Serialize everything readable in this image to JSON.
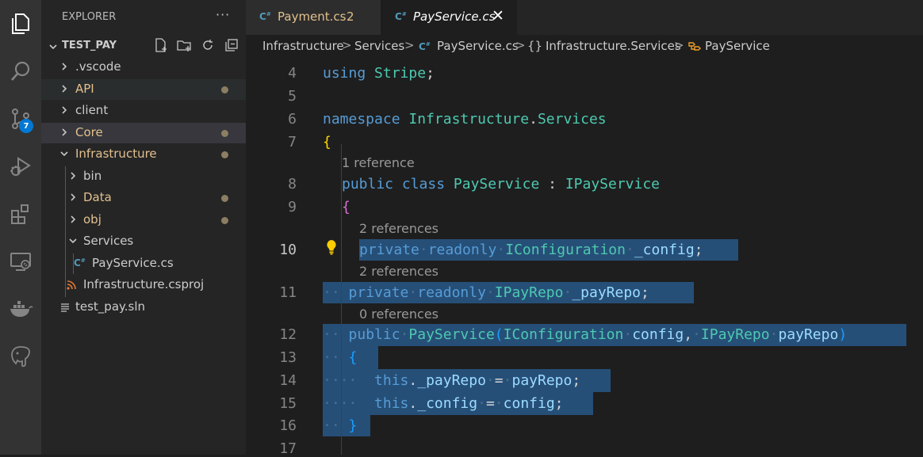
{
  "activity": {
    "scm_badge": "7"
  },
  "explorer": {
    "title": "EXPLORER",
    "more": "···",
    "root": "TEST_PAY",
    "items": [
      {
        "label": ".vscode"
      },
      {
        "label": "API"
      },
      {
        "label": "client"
      },
      {
        "label": "Core"
      },
      {
        "label": "Infrastructure"
      },
      {
        "label": "bin"
      },
      {
        "label": "Data"
      },
      {
        "label": "obj"
      },
      {
        "label": "Services"
      },
      {
        "label": "PayService.cs"
      },
      {
        "label": "Infrastructure.csproj"
      },
      {
        "label": "test_pay.sln"
      }
    ]
  },
  "tabs": [
    {
      "label": "Payment.cs",
      "problems": "2"
    },
    {
      "label": "PayService.cs"
    }
  ],
  "breadcrumb": {
    "items": [
      "Infrastructure",
      "Services",
      "PayService.cs",
      "Infrastructure.Services",
      "PayService"
    ],
    "sep": ">",
    "ns_glyph": "{}"
  },
  "code": {
    "line_numbers": [
      "4",
      "5",
      "6",
      "7",
      "8",
      "9",
      "10",
      "11",
      "12",
      "13",
      "14",
      "15",
      "16",
      "17"
    ],
    "lenses": [
      "1 reference",
      "2 references",
      "2 references",
      "0 references"
    ],
    "tokens": {
      "using": "using",
      "stripe": "Stripe",
      "semi": ";",
      "namespace": "namespace",
      "ns1": "Infrastructure",
      "dot": ".",
      "ns2": "Services",
      "lbrace": "{",
      "rbrace": "}",
      "public": "public",
      "class": "class",
      "payservice": "PayService",
      "colon": ":",
      "ipayservice": "IPayService",
      "private": "private",
      "readonly": "readonly",
      "iconfiguration": "IConfiguration",
      "config_field": "_config",
      "ipayrepo": "IPayRepo",
      "payrepo_field": "_payRepo",
      "lparen": "(",
      "rparen": ")",
      "comma": ",",
      "config": "config",
      "payrepo": "payRepo",
      "this": "this",
      "eq": "=",
      "ws2": "··",
      "ws3": "···",
      "ws4": "····",
      "ws5": "·····"
    }
  }
}
